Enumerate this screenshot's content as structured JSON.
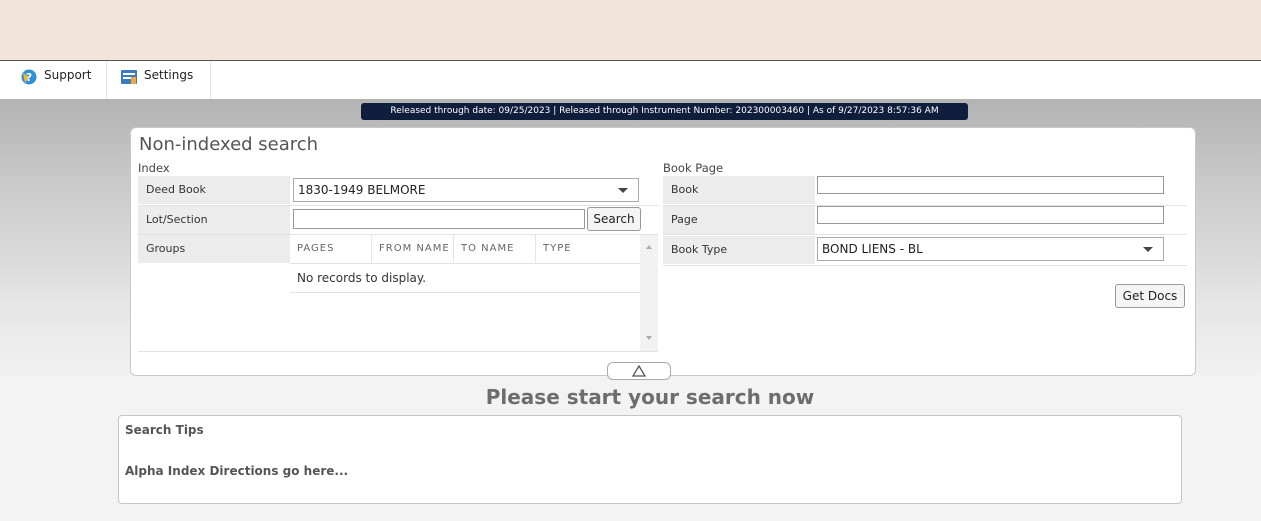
{
  "menu": {
    "support_label": "Support",
    "settings_label": "Settings"
  },
  "release_info": "Released through date: 09/25/2023 | Released through Instrument Number: 202300003460 | As of 9/27/2023 8:57:36 AM",
  "search": {
    "title": "Non-indexed search",
    "index_section": {
      "label": "Index",
      "deed_book_label": "Deed Book",
      "deed_book_value": "1830-1949 BELMORE",
      "lot_section_label": "Lot/Section",
      "lot_section_value": "",
      "search_button": "Search",
      "groups_label": "Groups",
      "groups_columns": [
        "PAGES",
        "FROM NAME",
        "TO NAME",
        "TYPE"
      ],
      "groups_empty": "No records to display."
    },
    "book_page_section": {
      "label": "Book Page",
      "book_label": "Book",
      "book_value": "",
      "page_label": "Page",
      "page_value": "",
      "book_type_label": "Book Type",
      "book_type_value": "BOND LIENS - BL",
      "get_docs_button": "Get Docs"
    }
  },
  "start_message": "Please start your search now",
  "tips": {
    "title": "Search Tips",
    "body": "Alpha Index Directions go here..."
  },
  "colors": {
    "top_band": "#f3e4da",
    "release_bar": "#0f1e3c",
    "support_icon": "#2f8fd8",
    "settings_icon": "#3a7dbf"
  }
}
